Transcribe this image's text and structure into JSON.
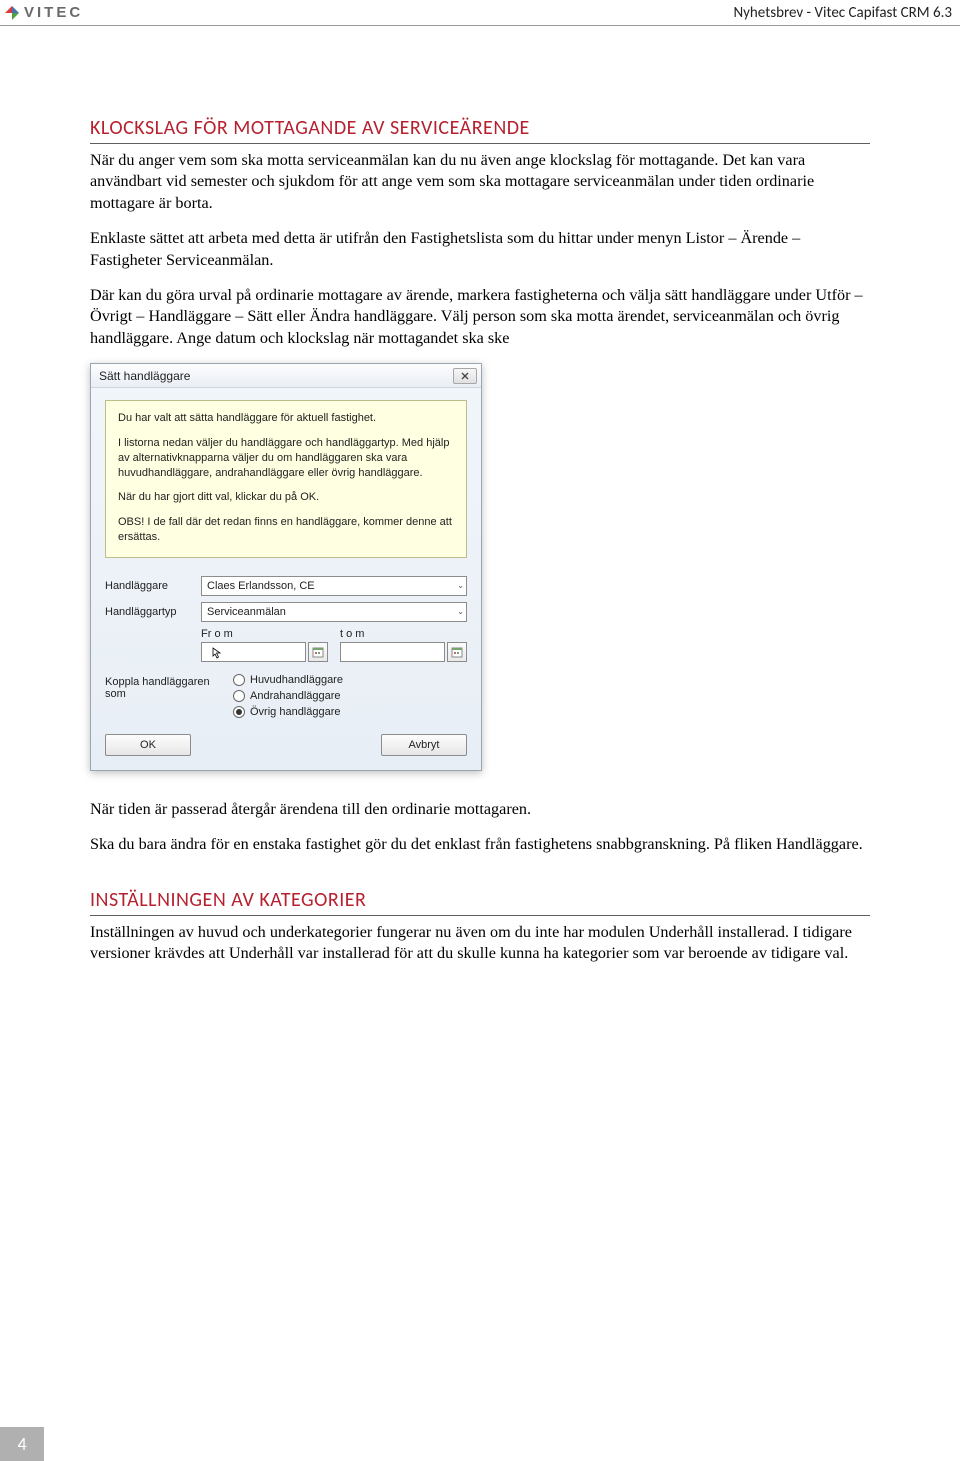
{
  "header": {
    "logo_text": "VITEC",
    "right": "Nyhetsbrev - Vitec Capifast CRM 6.3"
  },
  "page_number": "4",
  "section1": {
    "heading": "KLOCKSLAG FÖR MOTTAGANDE AV SERVICEÄRENDE",
    "p1": "När du anger vem som ska motta serviceanmälan kan du nu även ange klockslag för mottagande. Det kan vara användbart vid semester och sjukdom för att ange vem som ska mottagare serviceanmälan under tiden ordinarie mottagare är borta.",
    "p2": "Enklaste sättet att arbeta med detta är utifrån den Fastighetslista som du hittar under menyn Listor – Ärende – Fastigheter Serviceanmälan.",
    "p3": "Där kan du göra urval på ordinarie mottagare av ärende, markera fastigheterna och välja sätt handläggare under Utför – Övrigt – Handläggare – Sätt eller Ändra handläggare. Välj person som ska motta ärendet, serviceanmälan och övrig handläggare. Ange datum och klockslag när mottagandet ska ske"
  },
  "dialog": {
    "title": "Sätt handläggare",
    "close": "✕",
    "info": {
      "l1": "Du har valt att sätta handläggare för aktuell fastighet.",
      "l2": "I listorna nedan väljer du handläggare och handläggartyp. Med hjälp av alternativknapparna väljer du om handläggaren ska vara huvudhandläggare, andrahandläggare eller övrig handläggare.",
      "l3": "När du har gjort ditt val, klickar du på OK.",
      "l4": "OBS! I de fall där det redan finns en handläggare, kommer denne att ersättas."
    },
    "labels": {
      "handlaggare": "Handläggare",
      "handlaggartyp": "Handläggartyp",
      "from": "Fr o m",
      "tom": "t o m",
      "koppla": "Koppla handläggaren som"
    },
    "values": {
      "handlaggare": "Claes Erlandsson, CE",
      "handlaggartyp": "Serviceanmälan"
    },
    "radios": {
      "huvud": "Huvudhandläggare",
      "andra": "Andrahandläggare",
      "ovrig": "Övrig handläggare",
      "selected": "ovrig"
    },
    "buttons": {
      "ok": "OK",
      "cancel": "Avbryt"
    }
  },
  "after": {
    "p1": "När tiden är passerad återgår ärendena till den ordinarie mottagaren.",
    "p2": "Ska du bara ändra för en enstaka fastighet gör du det enklast från fastighetens snabbgranskning. På fliken Handläggare."
  },
  "section2": {
    "heading": "INSTÄLLNINGEN AV KATEGORIER",
    "p1": "Inställningen av huvud och underkategorier fungerar nu även om du inte har modulen Underhåll installerad. I tidigare versioner krävdes att Underhåll var installerad för att du skulle kunna ha kategorier som var beroende av tidigare val."
  }
}
